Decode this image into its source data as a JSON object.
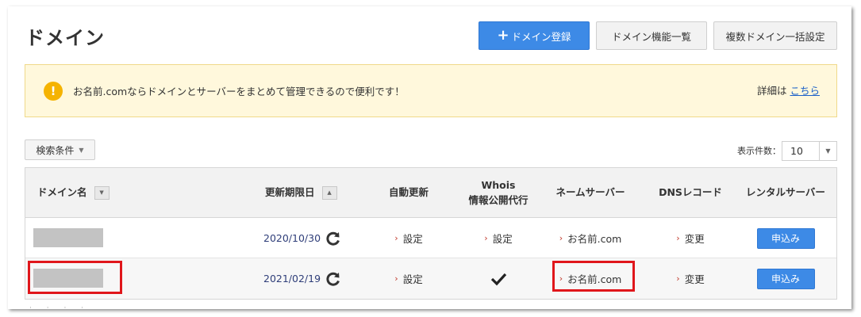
{
  "page": {
    "title": "ドメイン"
  },
  "toolbar": {
    "register_label": "ドメイン登録",
    "features_label": "ドメイン機能一覧",
    "bulk_label": "複数ドメイン一括設定"
  },
  "notice": {
    "icon": "!",
    "text": "お名前.comならドメインとサーバーをまとめて管理できるので便利です！",
    "detail_prefix": "詳細は",
    "detail_link": "こちら"
  },
  "filter": {
    "label": "検索条件"
  },
  "pagination": {
    "count_label": "表示件数：",
    "count_value": "10"
  },
  "table": {
    "headers": {
      "domain": "ドメイン名",
      "expiry": "更新期限日",
      "auto_renew": "自動更新",
      "whois_line1": "Whois",
      "whois_line2": "情報公開代行",
      "nameserver": "ネームサーバー",
      "dns": "DNSレコード",
      "rental": "レンタルサーバー"
    },
    "rows": [
      {
        "domain": "",
        "expiry": "2020/10/30",
        "auto_renew": "設定",
        "whois": "設定",
        "nameserver": "お名前.com",
        "dns": "変更",
        "rental": "申込み"
      },
      {
        "domain": "",
        "expiry": "2021/02/19",
        "auto_renew": "設定",
        "whois": "",
        "nameserver": "お名前.com",
        "dns": "変更",
        "rental": "申込み"
      }
    ]
  },
  "colors": {
    "accent": "#3d8ae6",
    "highlight": "#e0161b",
    "notice_bg": "#fff8dc",
    "warning_icon": "#f5b301"
  }
}
